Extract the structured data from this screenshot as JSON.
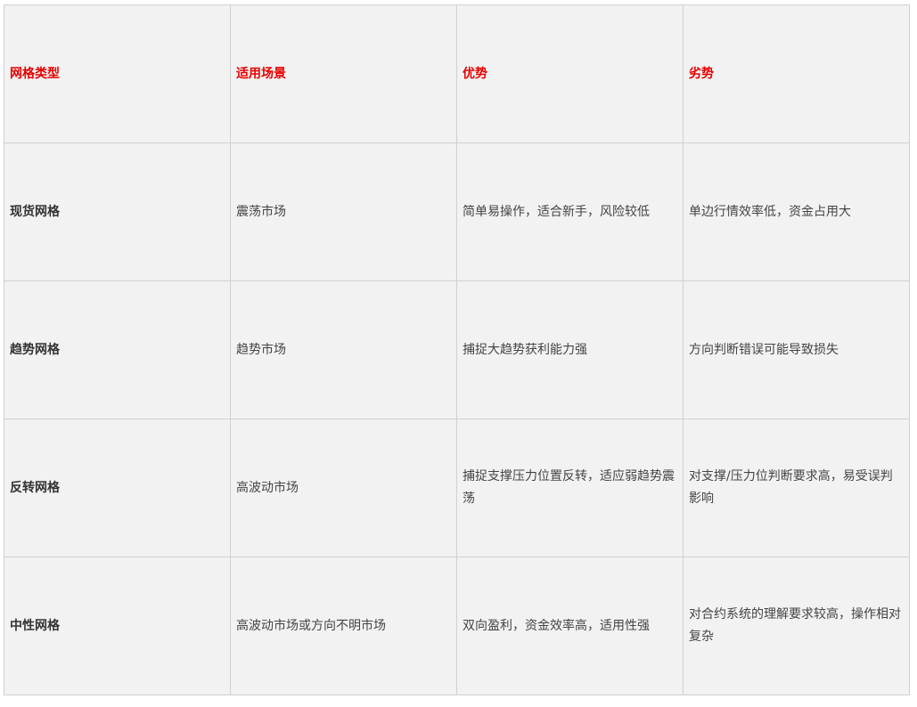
{
  "table": {
    "header": {
      "type": "网格类型",
      "scenario": "适用场景",
      "advantage": "优势",
      "disadvantage": "劣势"
    },
    "rows": [
      {
        "type": "现货网格",
        "scenario": "震荡市场",
        "advantage": "简单易操作，适合新手，风险较低",
        "disadvantage": "单边行情效率低，资金占用大"
      },
      {
        "type": "趋势网格",
        "scenario": "趋势市场",
        "advantage": "捕捉大趋势获利能力强",
        "disadvantage": "方向判断错误可能导致损失"
      },
      {
        "type": "反转网格",
        "scenario": "高波动市场",
        "advantage": "捕捉支撑压力位置反转，适应弱趋势震荡",
        "disadvantage": "对支撑/压力位判断要求高，易受误判影响"
      },
      {
        "type": "中性网格",
        "scenario": "高波动市场或方向不明市场",
        "advantage": "双向盈利，资金效率高，适用性强",
        "disadvantage": "对合约系统的理解要求较高，操作相对复杂"
      }
    ]
  },
  "colors": {
    "header_text": "#e60000",
    "cell_background": "#f2f2f2",
    "border": "#d0d0d0",
    "body_text": "#444444"
  }
}
